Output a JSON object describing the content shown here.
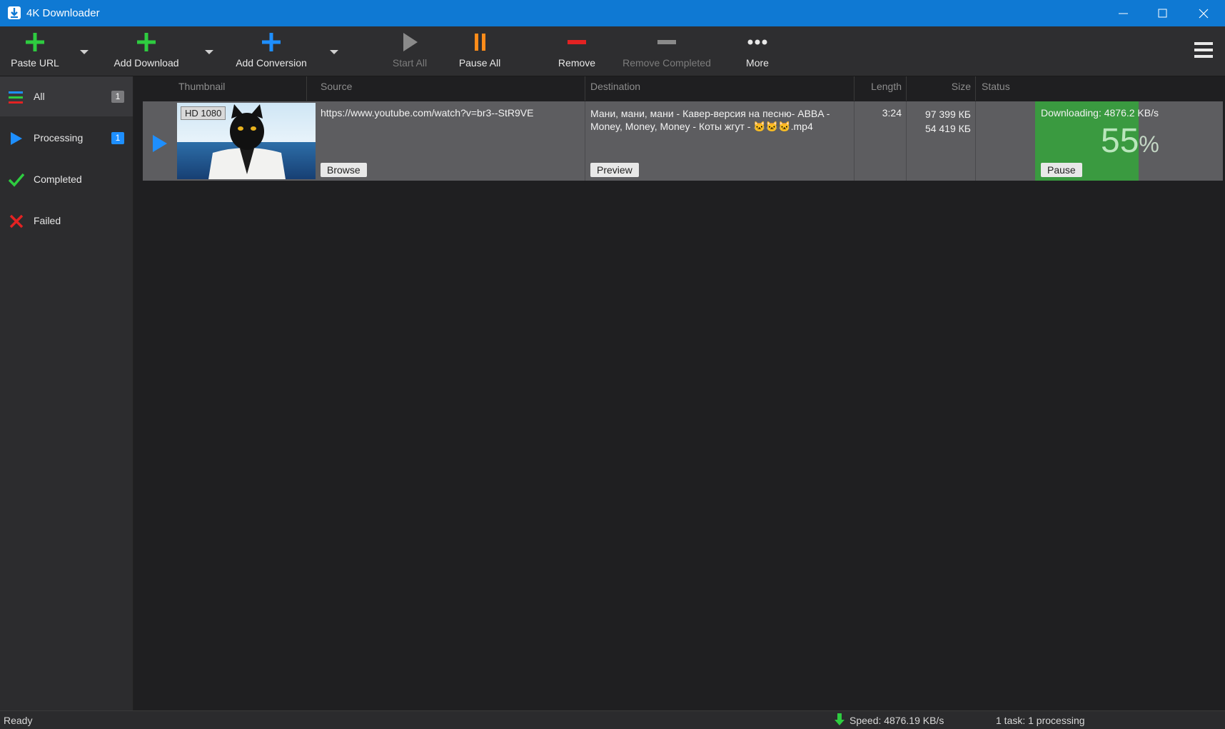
{
  "window": {
    "title": "4K Downloader",
    "controls": [
      "minimize",
      "maximize",
      "close"
    ]
  },
  "toolbar": {
    "buttons": [
      {
        "label": "Paste URL",
        "icon": "plus-green-icon",
        "has_dropdown": true,
        "enabled": true
      },
      {
        "label": "Add Download",
        "icon": "plus-green-icon",
        "has_dropdown": true,
        "enabled": true
      },
      {
        "label": "Add Conversion",
        "icon": "plus-blue-icon",
        "has_dropdown": true,
        "enabled": true
      },
      {
        "label": "Start All",
        "icon": "play-icon",
        "enabled": false
      },
      {
        "label": "Pause All",
        "icon": "pause-icon",
        "enabled": true
      },
      {
        "label": "Remove",
        "icon": "minus-red-icon",
        "enabled": true
      },
      {
        "label": "Remove Completed",
        "icon": "minus-gray-icon",
        "enabled": false
      },
      {
        "label": "More",
        "icon": "dots-icon",
        "enabled": true
      }
    ],
    "menu_icon": "hamburger-icon"
  },
  "sidebar": {
    "items": [
      {
        "label": "All",
        "count": "1",
        "icon": "list-icon",
        "active": true
      },
      {
        "label": "Processing",
        "count": "1",
        "icon": "play-icon",
        "active": false
      },
      {
        "label": "Completed",
        "count": "",
        "icon": "check-icon",
        "active": false
      },
      {
        "label": "Failed",
        "count": "",
        "icon": "x-icon",
        "active": false
      }
    ]
  },
  "table": {
    "columns": [
      "Thumbnail",
      "Source",
      "Destination",
      "Length",
      "Size",
      "Status"
    ],
    "rows": [
      {
        "quality_badge": "HD 1080",
        "source": "https://www.youtube.com/watch?v=br3--StR9VE",
        "browse_label": "Browse",
        "destination": "Мани, мани, мани - Кавер-версия на песню- ABBA - Money, Money, Money - Коты жгут - 🐱🐱🐱.mp4",
        "preview_label": "Preview",
        "length": "3:24",
        "size_total": "97 399 КБ",
        "size_done": "54 419 КБ",
        "status": "Downloading: 4876.2 KB/s",
        "progress_percent": 55,
        "percent_number": "55",
        "percent_sign": "%",
        "pause_label": "Pause"
      }
    ]
  },
  "statusbar": {
    "left": "Ready",
    "speed": "Speed: 4876.19 KB/s",
    "tasks": "1 task: 1 processing"
  },
  "colors": {
    "titlebar": "#0f79d3",
    "progress": "#3a9a40",
    "accent_blue": "#1e8fff",
    "green": "#2ecc40",
    "orange": "#ff8c1a",
    "red": "#e32222"
  }
}
